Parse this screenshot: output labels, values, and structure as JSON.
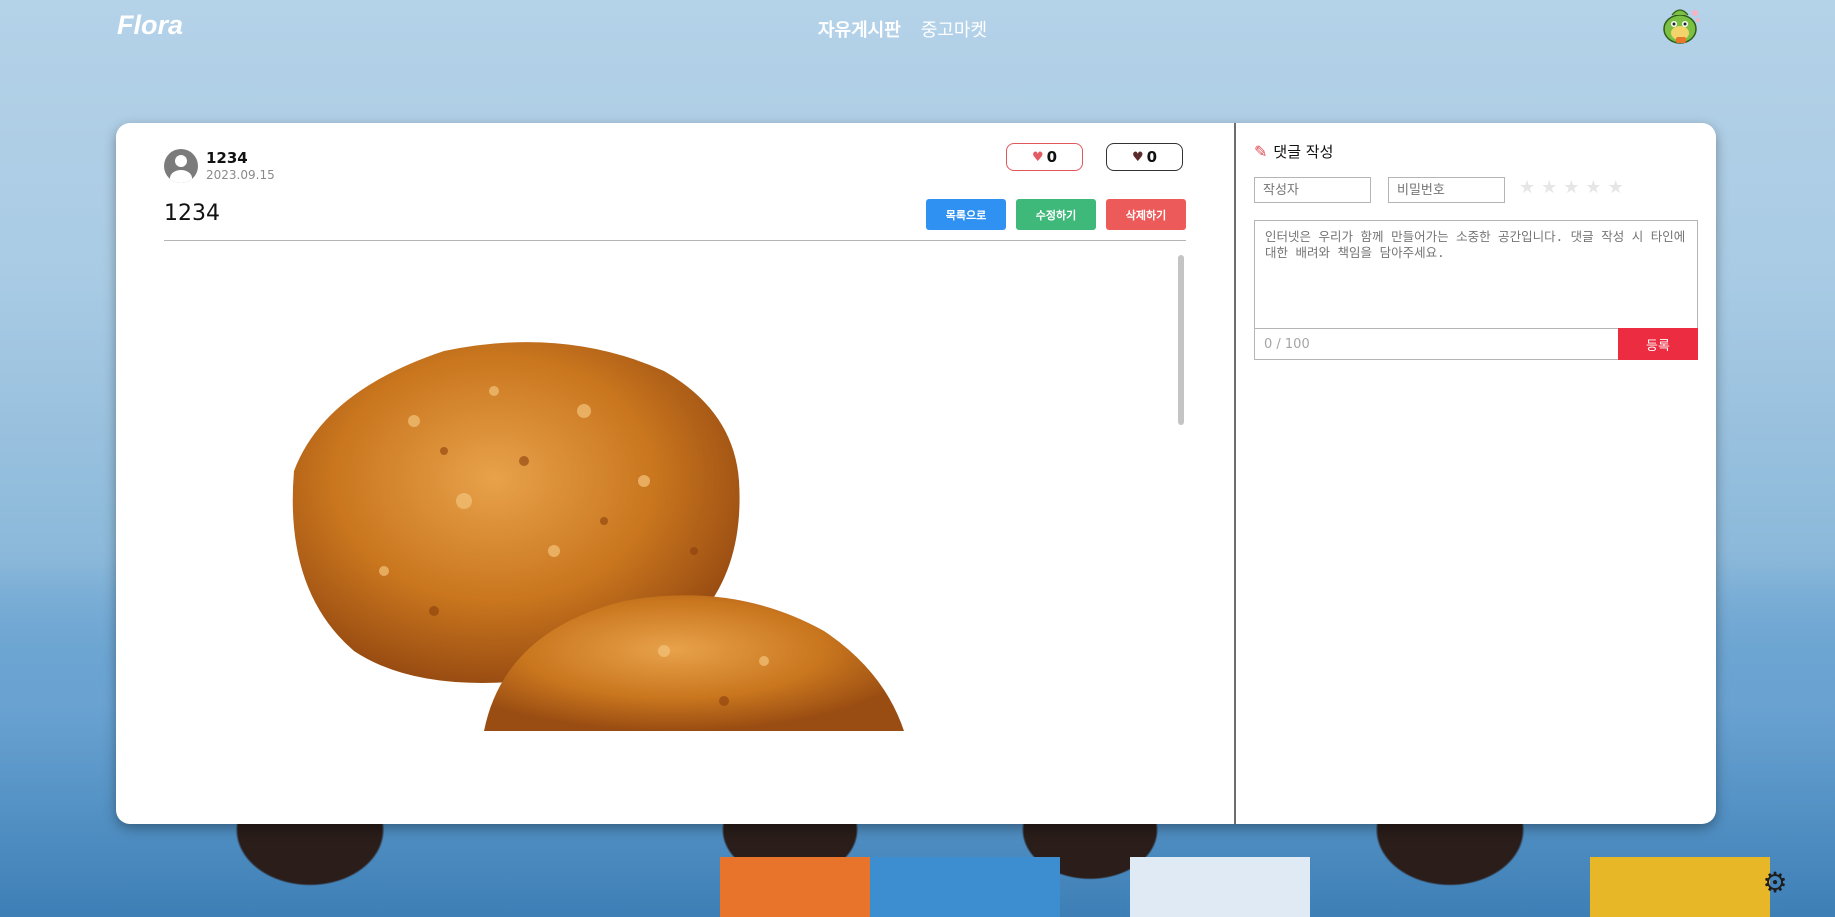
{
  "header": {
    "logo": "Flora",
    "nav": [
      {
        "label": "자유게시판",
        "active": true
      },
      {
        "label": "중고마켓",
        "active": false
      }
    ],
    "user_avatar_icon": "mascot-avatar-icon"
  },
  "post": {
    "author": "1234",
    "date": "2023.09.15",
    "title": "1234",
    "likes": "0",
    "dislikes": "0",
    "buttons": {
      "list": "목록으로",
      "edit": "수정하기",
      "delete": "삭제하기"
    },
    "colors": {
      "list": "#2f92f2",
      "edit": "#3fb97a",
      "delete": "#ec5b59"
    }
  },
  "comment": {
    "heading": "댓글 작성",
    "writer_placeholder": "작성자",
    "password_placeholder": "비밀번호",
    "rating_stars": 5,
    "body_placeholder": "인터넷은 우리가 함께 만들어가는 소중한 공간입니다. 댓글 작성 시 타인에 대한 배려와 책임을 담아주세요.",
    "counter": "0 / 100",
    "submit_label": "등록",
    "accent": "#ec2c40"
  },
  "settings_icon": "gear-icon"
}
